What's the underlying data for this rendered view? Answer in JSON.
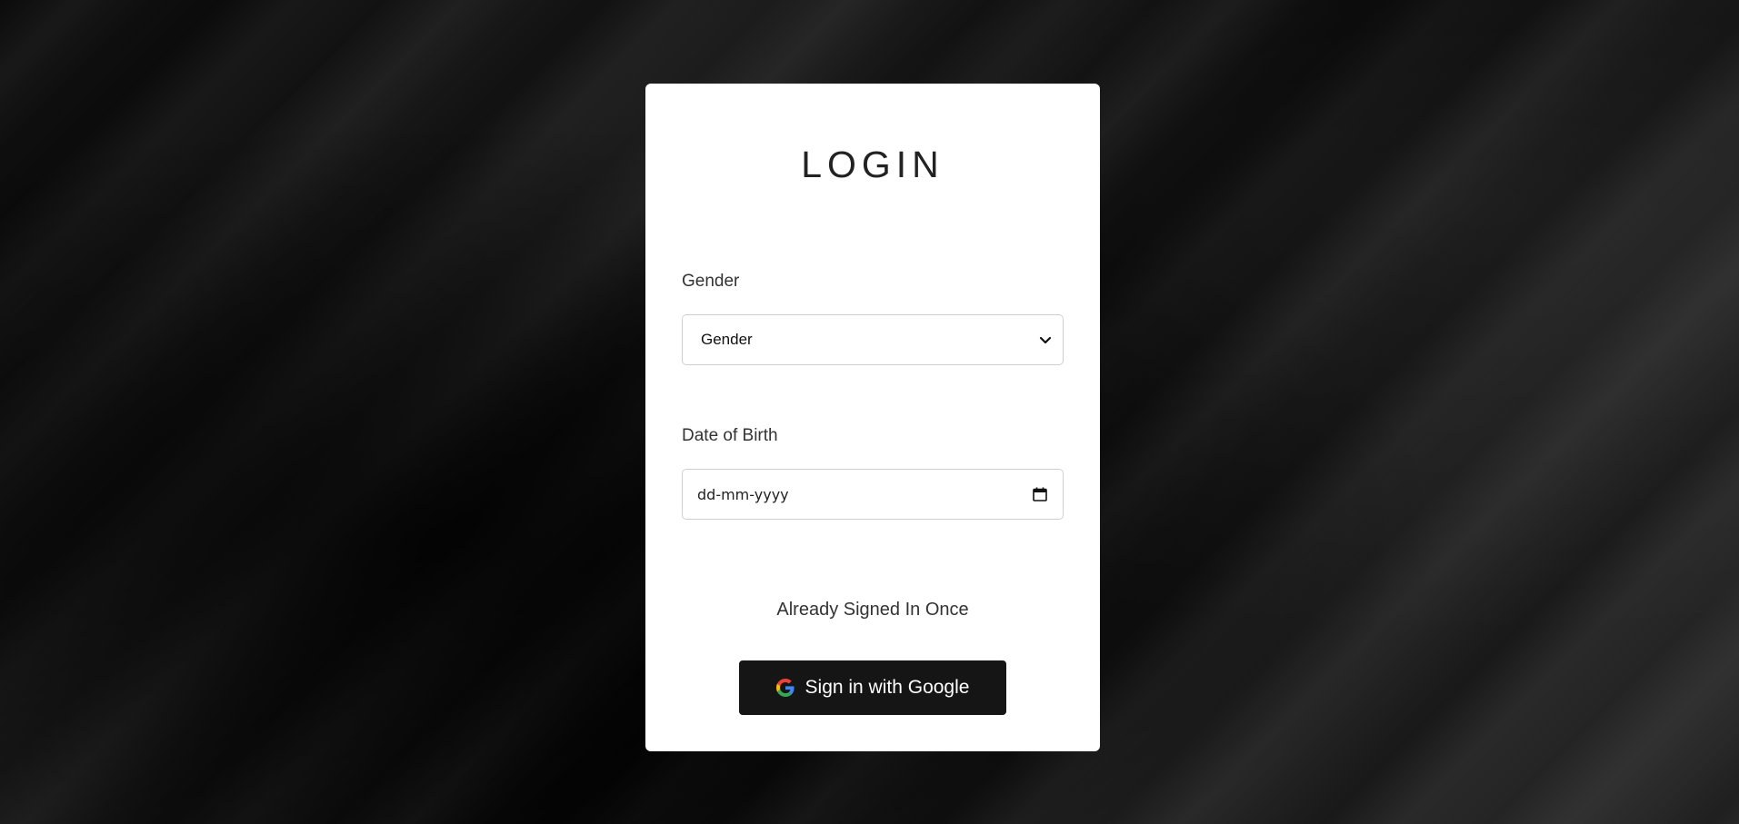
{
  "login": {
    "title": "LOGIN",
    "gender": {
      "label": "Gender",
      "selected": "Gender"
    },
    "dob": {
      "label": "Date of Birth",
      "placeholder": "dd-mm-yyyy"
    },
    "already_text": "Already Signed In Once",
    "google_button": {
      "label": "Sign in with Google",
      "icon": "google-icon"
    }
  },
  "colors": {
    "card_bg": "#ffffff",
    "button_bg": "#151515",
    "page_bg": "#000000"
  }
}
